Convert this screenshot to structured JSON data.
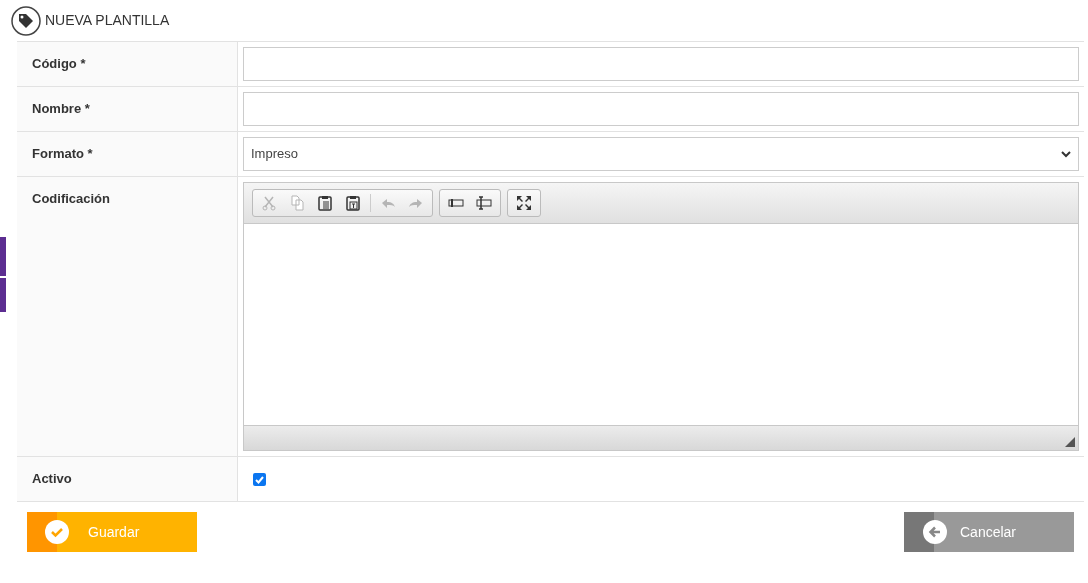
{
  "header": {
    "title": "NUEVA PLANTILLA"
  },
  "fields": [
    {
      "kind": "text",
      "label": "Código *"
    },
    {
      "kind": "text",
      "label": "Nombre *"
    },
    {
      "kind": "select",
      "label": "Formato *",
      "value": "Impreso"
    },
    {
      "kind": "editor",
      "label": "Codificación",
      "toolbar": [
        [
          {
            "kind": "cut",
            "disabled": true
          },
          {
            "kind": "copy",
            "disabled": true
          },
          {
            "kind": "paste",
            "disabled": false
          },
          {
            "kind": "paste-text",
            "disabled": false
          },
          {
            "kind": "undo",
            "disabled": true
          },
          {
            "kind": "redo",
            "disabled": true
          }
        ],
        [
          {
            "kind": "field",
            "disabled": false
          },
          {
            "kind": "field-alt",
            "disabled": false
          }
        ],
        [
          {
            "kind": "maximize",
            "disabled": false
          }
        ]
      ]
    },
    {
      "kind": "checkbox",
      "label": "Activo",
      "checked": true
    }
  ],
  "buttons": [
    {
      "kind": "save",
      "label": "Guardar"
    },
    {
      "kind": "cancel",
      "label": "Cancelar"
    }
  ]
}
